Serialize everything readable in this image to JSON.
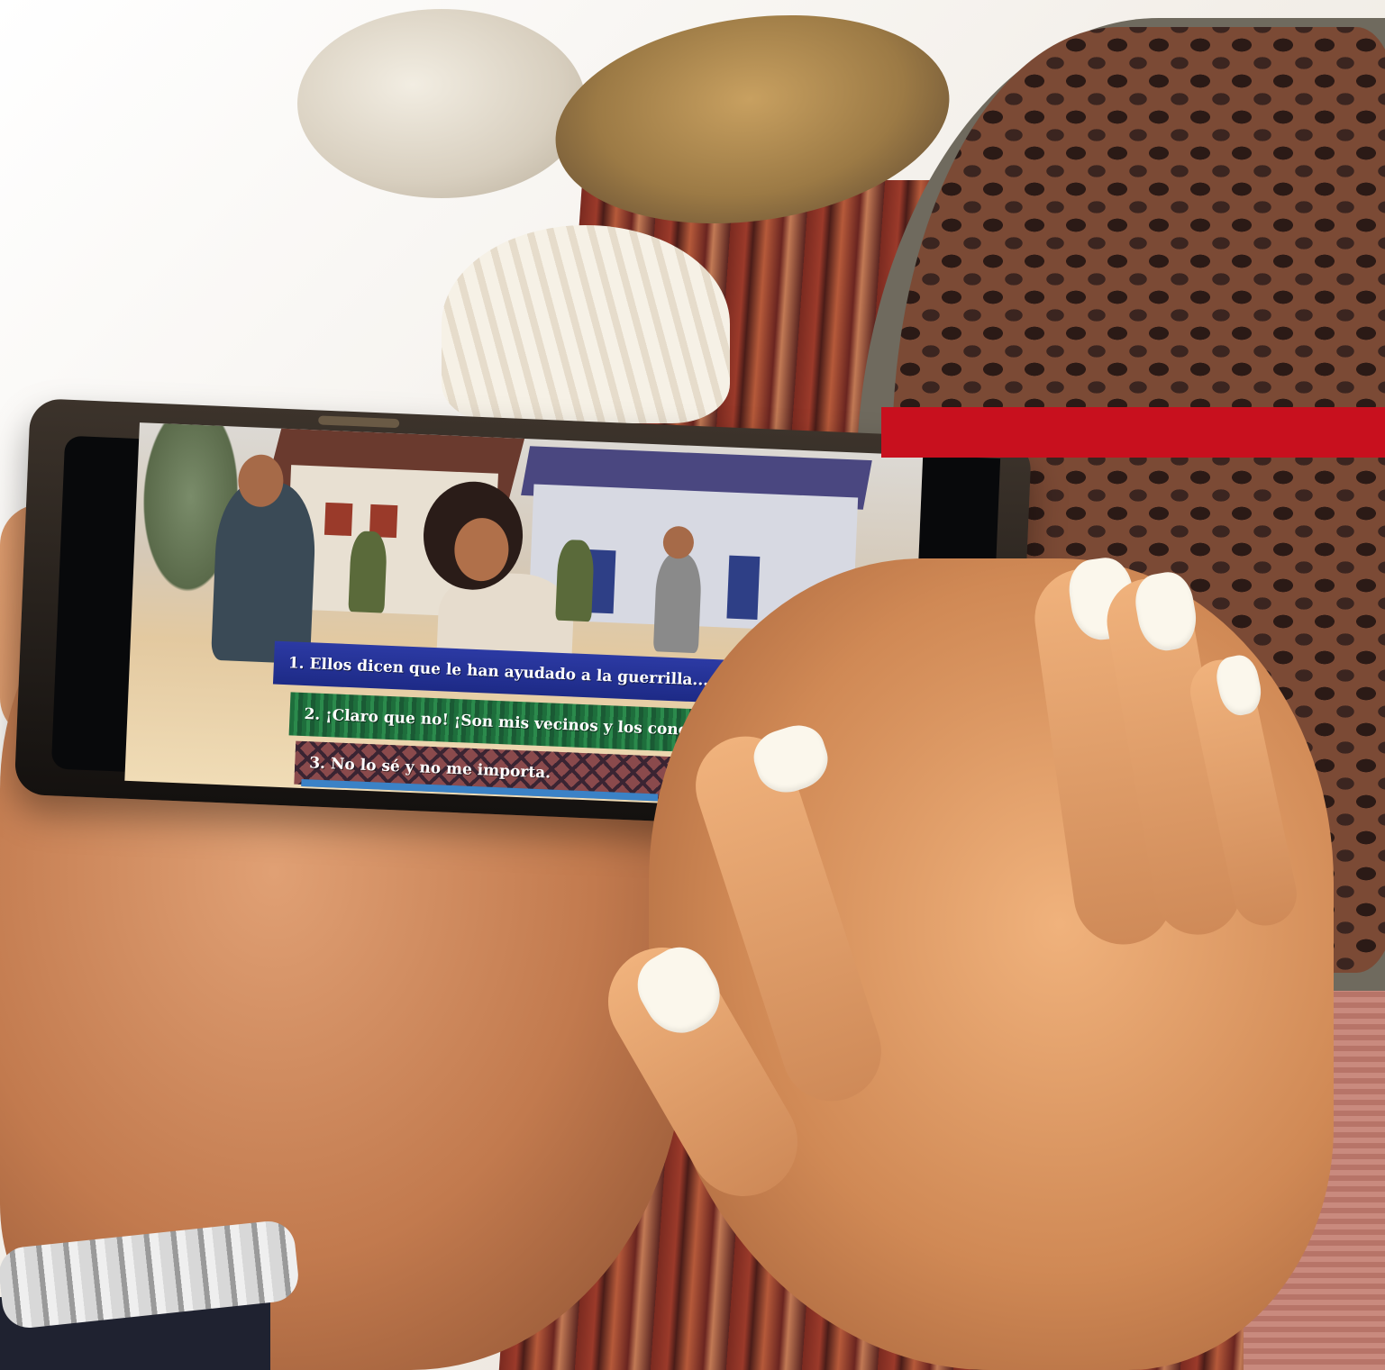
{
  "game": {
    "dialogue_options": [
      "1. Ellos dicen que le han ayudado a la guerrilla...",
      "2. ¡Claro que no! ¡Son mis vecinos y los conocemos!",
      "3. No lo sé y no me importa."
    ],
    "timer_progress_fraction": 0.66
  },
  "colors": {
    "red_band": "#c8101e",
    "option_1_blue": "#2c3aa4",
    "option_2_green": "#2b8a4c",
    "option_3_maroon": "#8a4a4c",
    "timer_blue": "#3b82c6"
  }
}
